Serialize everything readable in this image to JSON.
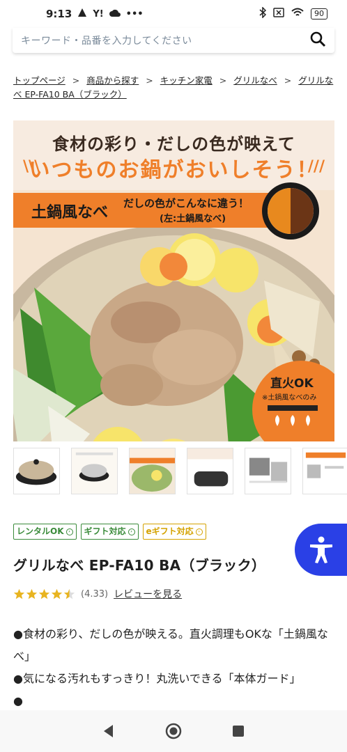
{
  "status_bar": {
    "time": "9:13",
    "notif_icons": [
      "hiking-icon",
      "yahoo-icon",
      "cloud-icon",
      "more-icon"
    ],
    "yahoo_text": "Y!",
    "more_text": "•••",
    "battery": "90"
  },
  "search": {
    "placeholder": "キーワード・品番を入力してください"
  },
  "breadcrumb": {
    "items": [
      "トップページ",
      "商品から探す",
      "キッチン家電",
      "グリルなべ",
      "グリルなべ EP-FA10 BA（ブラック）"
    ],
    "separator": ">"
  },
  "hero": {
    "headline": "食材の彩り・だしの色が映えて",
    "subheadline": "いつものお鍋がおいしそう！",
    "band_main": "土鍋風なべ",
    "band_sub1": "だしの色がこんなに違う！",
    "band_sub2": "(左:土鍋風なべ)",
    "badge_title": "直火OK",
    "badge_note": "※土鍋風なべのみ",
    "colors": {
      "accent": "#ef7f2a",
      "cream": "#f7ebe0"
    }
  },
  "thumbnails": [
    "thumb-product-photo",
    "thumb-product-diagram",
    "thumb-nabe-photo",
    "thumb-dashi-compare",
    "thumb-usage",
    "thumb-features"
  ],
  "tags": [
    {
      "label": "レンタルOK",
      "color": "green"
    },
    {
      "label": "ギフト対応",
      "color": "green"
    },
    {
      "label": "eギフト対応",
      "color": "yellow"
    }
  ],
  "product": {
    "title": "グリルなべ EP-FA10 BA（ブラック）",
    "rating_text": "(4.33)",
    "rating_value": 4.33,
    "review_link": "レビューを見る"
  },
  "description": {
    "lines": [
      "●食材の彩り、だしの色が映える。直火調理もOKな「土鍋風なべ」",
      "●気になる汚れもすっきり！丸洗いできる「本体ガード」",
      "●"
    ]
  },
  "nav": {
    "icons": [
      "back-icon",
      "home-icon",
      "recents-icon"
    ]
  }
}
